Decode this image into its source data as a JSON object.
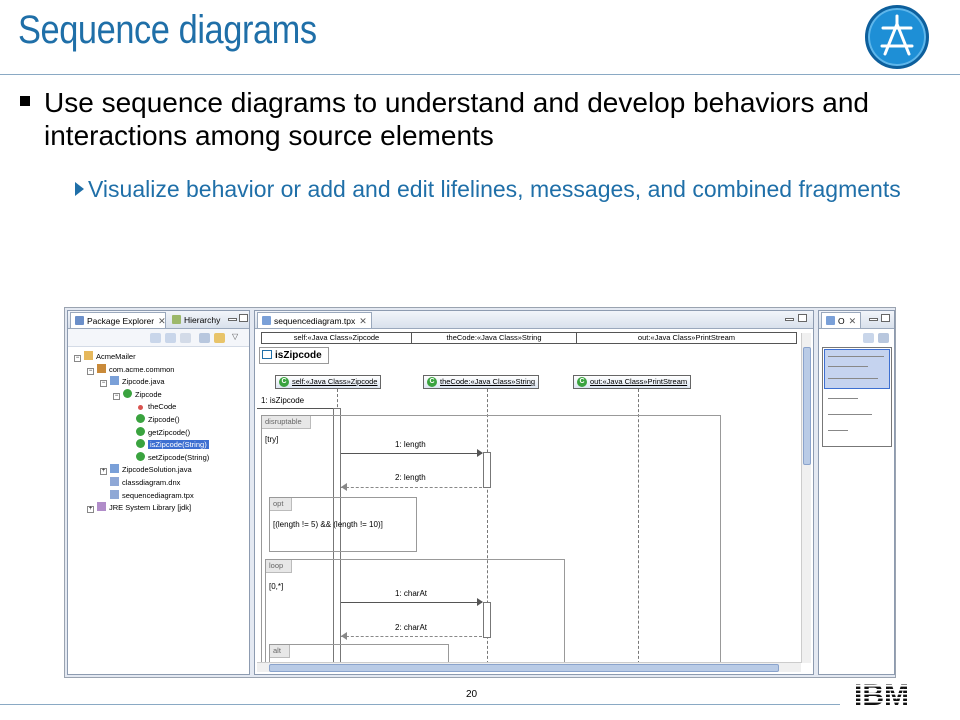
{
  "slide": {
    "title": "Sequence diagrams",
    "bullet1": "Use sequence diagrams to understand and develop behaviors and interactions among source elements",
    "bullet2": "Visualize behavior or add and edit lifelines, messages, and combined fragments",
    "page_number": "20",
    "footer_logo": "IBM"
  },
  "colors": {
    "title": "#1f6fa8",
    "selection": "#3d6fd1",
    "class_icon": "#3aa33f"
  },
  "explorer": {
    "tabs": {
      "package_explorer": "Package Explorer",
      "hierarchy": "Hierarchy"
    },
    "tree": [
      {
        "label": "AcmeMailer",
        "depth": 0,
        "icon": "project-icon"
      },
      {
        "label": "com.acme.common",
        "depth": 1,
        "icon": "package-icon"
      },
      {
        "label": "Zipcode.java",
        "depth": 2,
        "icon": "java-file-icon"
      },
      {
        "label": "Zipcode",
        "depth": 3,
        "icon": "class-icon"
      },
      {
        "label": "theCode",
        "depth": 4,
        "icon": "field-icon"
      },
      {
        "label": "Zipcode()",
        "depth": 4,
        "icon": "constructor-icon"
      },
      {
        "label": "getZipcode()",
        "depth": 4,
        "icon": "method-icon"
      },
      {
        "label": "isZipcode(String)",
        "depth": 4,
        "icon": "method-icon",
        "selected": true
      },
      {
        "label": "setZipcode(String)",
        "depth": 4,
        "icon": "method-icon"
      },
      {
        "label": "ZipcodeSolution.java",
        "depth": 2,
        "icon": "java-file-icon"
      },
      {
        "label": "classdiagram.dnx",
        "depth": 2,
        "icon": "diagram-file-icon"
      },
      {
        "label": "sequencediagram.tpx",
        "depth": 2,
        "icon": "diagram-file-icon"
      },
      {
        "label": "JRE System Library [jdk]",
        "depth": 1,
        "icon": "library-icon"
      }
    ]
  },
  "editor": {
    "tab": "sequencediagram.tpx",
    "lifeline_bar": [
      "self:«Java Class»Zipcode",
      "theCode:«Java Class»String",
      "out:«Java Class»PrintStream"
    ],
    "frame_title": "isZipcode",
    "lifelines": [
      "self:«Java Class»Zipcode",
      "theCode:«Java Class»String",
      "out:«Java Class»PrintStream"
    ],
    "entry_message": "1: isZipcode",
    "fragments": {
      "disruptable": {
        "tag": "disruptable",
        "guard": "[try]"
      },
      "opt": {
        "tag": "opt",
        "guard": "[(length != 5) && (length != 10)]"
      },
      "loop": {
        "tag": "loop",
        "guard": "[0,*]"
      },
      "alt": {
        "tag": "alt"
      }
    },
    "messages": [
      "1: length",
      "2: length",
      "1: charAt",
      "2: charAt"
    ]
  },
  "outline": {
    "tab": "O"
  }
}
